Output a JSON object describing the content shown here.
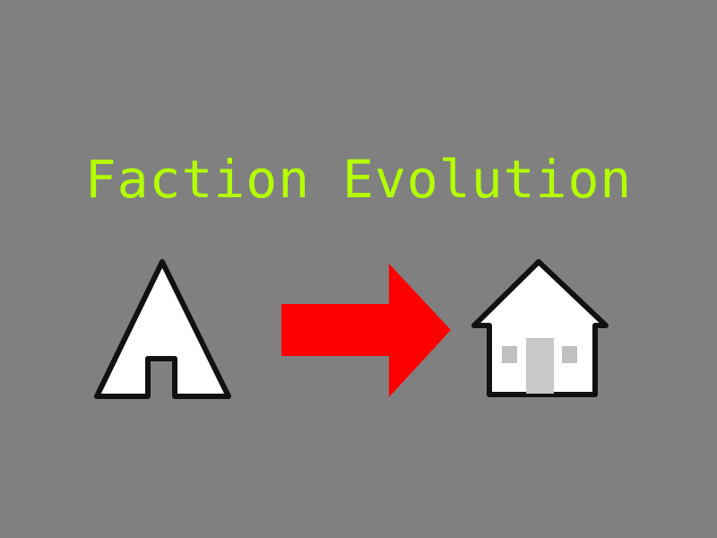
{
  "title": "Faction Evolution",
  "colors": {
    "background": "#808080",
    "title": "#b3ff00",
    "arrow": "#ff0000",
    "icon_fill": "#ffffff",
    "icon_outline": "#111111",
    "house_door": "#c8c8c8",
    "house_window": "#c0c0c0"
  },
  "icons": {
    "from": "tent-icon",
    "transition": "right-arrow-icon",
    "to": "house-icon"
  }
}
